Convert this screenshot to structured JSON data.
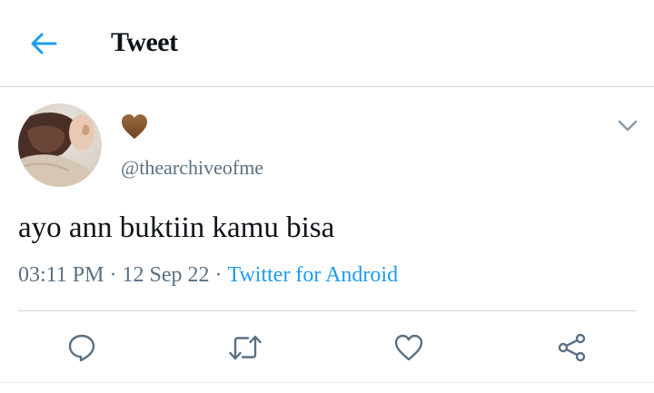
{
  "header": {
    "title": "Tweet",
    "back_icon": "arrow-left-icon"
  },
  "tweet": {
    "display_name_emoji": "brown-heart",
    "handle": "@thearchiveofme",
    "text": "ayo ann buktiin kamu bisa",
    "time": "03:11 PM",
    "separator": "·",
    "date": "12 Sep 22",
    "source": "Twitter for Android"
  },
  "actions": {
    "reply_icon": "reply-icon",
    "retweet_icon": "retweet-icon",
    "like_icon": "heart-icon",
    "share_icon": "share-icon"
  },
  "colors": {
    "accent": "#1d9bf0",
    "text": "#0f1419",
    "secondary": "#5b7083",
    "divider": "#cfd9de",
    "heart_emoji": "#8b5a2b"
  }
}
